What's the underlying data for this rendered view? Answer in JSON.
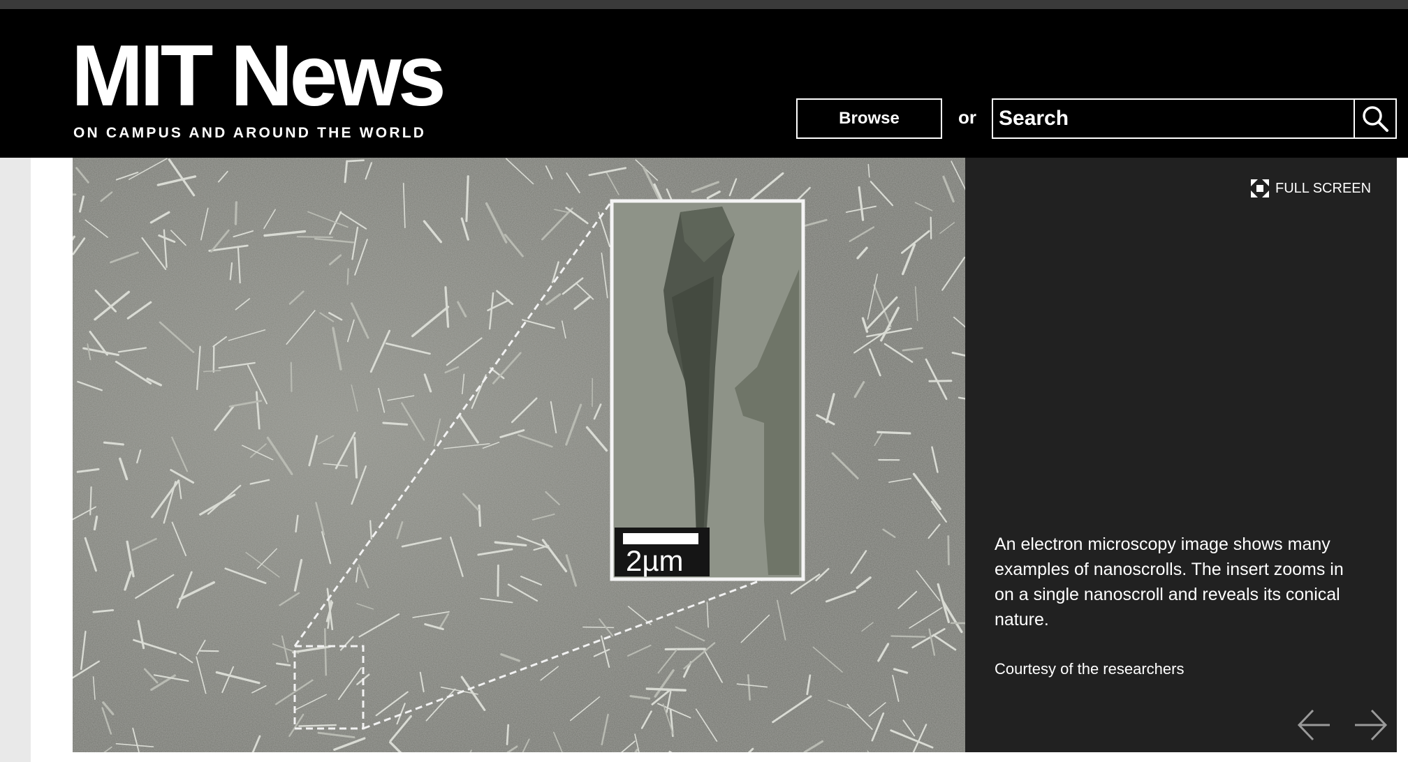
{
  "header": {
    "logo_title": "MIT News",
    "logo_tagline": "ON CAMPUS AND AROUND THE WORLD",
    "browse_label": "Browse",
    "or_label": "or",
    "search_placeholder": "Search"
  },
  "slideshow": {
    "fullscreen_label": "FULL SCREEN",
    "image_scale_label": "2µm",
    "caption": "An electron microscopy image shows many examples of nanoscrolls. The insert zooms in on a single nanoscroll and reveals its conical nature.",
    "credit": "Courtesy of the researchers"
  },
  "icons": {
    "search": "search-icon",
    "fullscreen": "fullscreen-icon",
    "prev": "arrow-left-icon",
    "next": "arrow-right-icon"
  },
  "colors": {
    "header_bg": "#000000",
    "caption_bg": "#212121",
    "text": "#ffffff"
  }
}
